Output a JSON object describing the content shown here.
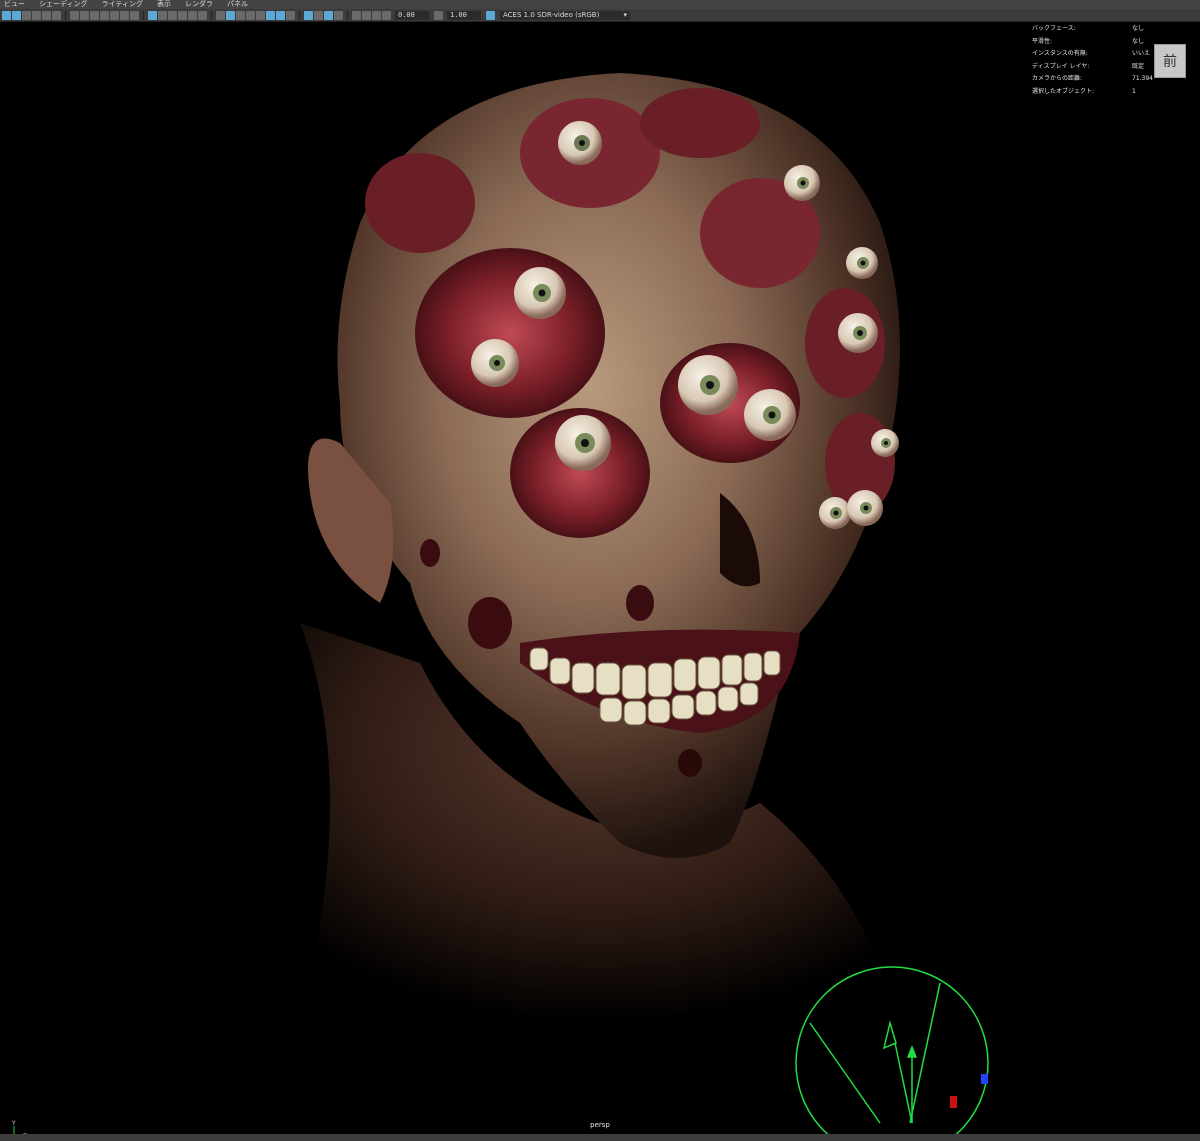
{
  "menus": [
    "ビュー",
    "シェーディング",
    "ライティング",
    "表示",
    "レンダラ",
    "パネル"
  ],
  "toolbar": {
    "exposure": "0.00",
    "gamma": "1.00",
    "colorspace": "ACES 1.0 SDR-video (sRGB)"
  },
  "hud": [
    {
      "label": "バックフェース:",
      "value": "なし"
    },
    {
      "label": "平滑性:",
      "value": "なし"
    },
    {
      "label": "インスタンスの有無:",
      "value": "いいえ"
    },
    {
      "label": "ディスプレイ レイヤ:",
      "value": "既定"
    },
    {
      "label": "カメラからの距離:",
      "value": "71.394"
    },
    {
      "label": "選択したオブジェクト:",
      "value": "1"
    }
  ],
  "viewcube_label": "前",
  "camera_label": "persp",
  "axis": {
    "y": "Y",
    "z": "Z"
  }
}
